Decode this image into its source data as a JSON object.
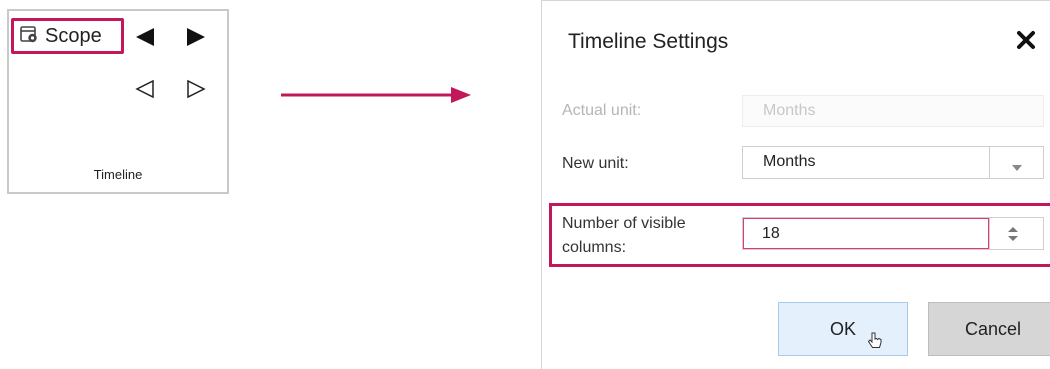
{
  "ribbon": {
    "scope_label": "Scope",
    "group_label": "Timeline",
    "icons": {
      "scope": "calendar-gear-icon",
      "prev_filled": "triangle-left-filled-icon",
      "next_filled": "triangle-right-filled-icon",
      "prev_outline": "triangle-left-outline-icon",
      "next_outline": "triangle-right-outline-icon"
    }
  },
  "connector": {
    "icon": "arrow-right-icon",
    "color": "#c2185b"
  },
  "dialog": {
    "title": "Timeline Settings",
    "close_icon": "close-icon",
    "actual_unit": {
      "label": "Actual unit:",
      "value": "Months"
    },
    "new_unit": {
      "label": "New unit:",
      "value": "Months"
    },
    "visible_columns": {
      "label_line1": "Number of visible",
      "label_line2": "columns:",
      "value": "18"
    },
    "ok_label": "OK",
    "cancel_label": "Cancel"
  },
  "colors": {
    "highlight": "#c2185b",
    "ok_bg": "#e4f0fb",
    "cancel_bg": "#d6d6d6"
  }
}
